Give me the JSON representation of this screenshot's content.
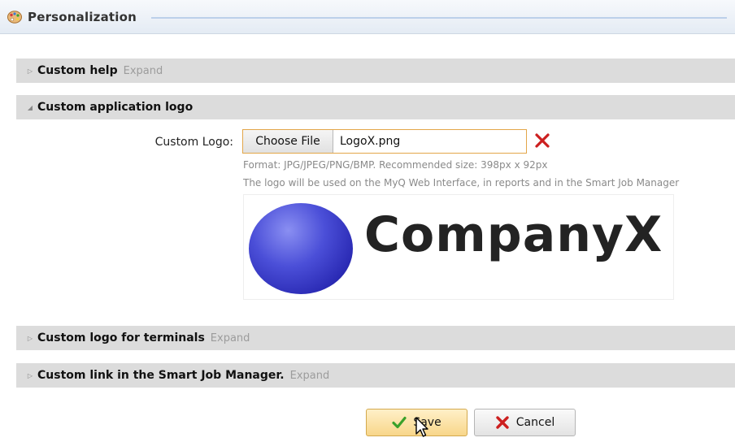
{
  "window": {
    "title": "Personalization",
    "title_icon": "palette-icon"
  },
  "sections": {
    "custom_help": {
      "label": "Custom help",
      "expand": "Expand"
    },
    "custom_app_logo": {
      "label": "Custom application logo"
    },
    "custom_logo_terminals": {
      "label": "Custom logo for terminals",
      "expand": "Expand"
    },
    "custom_link": {
      "label": "Custom link in the Smart Job Manager.",
      "expand": "Expand"
    }
  },
  "logo_form": {
    "field_label": "Custom Logo:",
    "choose_button": "Choose File",
    "file_name": "LogoX.png",
    "remove_icon": "remove-x-icon",
    "hint_format": "Format: JPG/JPEG/PNG/BMP. Recommended size: 398px x 92px",
    "hint_usage": "The logo will be used on the MyQ Web Interface, in reports and in the Smart Job Manager",
    "preview_text": "CompanyX"
  },
  "buttons": {
    "save": "Save",
    "cancel": "Cancel"
  },
  "colors": {
    "section_bg": "#dcdcdc",
    "save_accent": "#f8d68a",
    "remove_red": "#cc1f1f",
    "check_green": "#3aa12b"
  }
}
